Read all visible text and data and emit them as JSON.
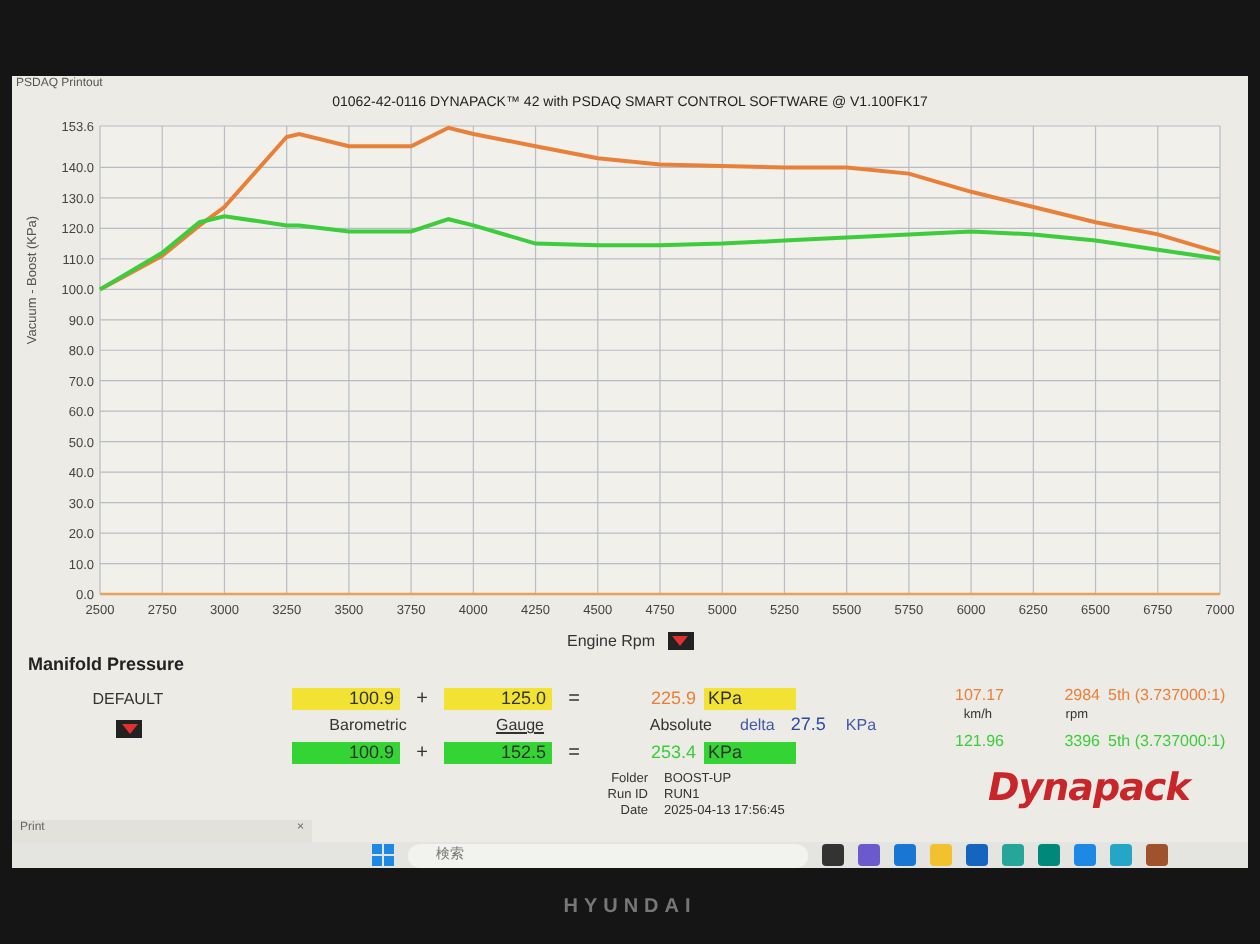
{
  "window": {
    "title": "PSDAQ Printout"
  },
  "chart": {
    "chart_data": {
      "type": "line",
      "title": "01062-42-0116 DYNAPACK™ 42 with PSDAQ SMART CONTROL SOFTWARE @ V1.100FK17",
      "xlabel": "Engine Rpm",
      "ylabel": "Vacuum - Boost (KPa)",
      "x": [
        2500,
        2750,
        2900,
        3000,
        3250,
        3300,
        3500,
        3750,
        3900,
        4000,
        4250,
        4500,
        4750,
        5000,
        5250,
        5500,
        5750,
        6000,
        6250,
        6500,
        6750,
        7000
      ],
      "series": [
        {
          "color": "#e8803a",
          "values": [
            100,
            111,
            121,
            127,
            150,
            151,
            147,
            147,
            153,
            151,
            147,
            143,
            141,
            140.5,
            140,
            140,
            138,
            132,
            127,
            122,
            118,
            112
          ]
        },
        {
          "color": "#3ccc3c",
          "values": [
            100,
            112,
            122,
            124,
            121,
            121,
            119,
            119,
            123,
            121,
            115,
            114.5,
            114.5,
            115,
            116,
            117,
            118,
            119,
            118,
            116,
            113,
            110
          ]
        }
      ],
      "grid": true,
      "xlim": [
        2500,
        7000
      ],
      "ylim": [
        0,
        153.6
      ],
      "xticks": [
        2500,
        2750,
        3000,
        3250,
        3500,
        3750,
        4000,
        4250,
        4500,
        4750,
        5000,
        5250,
        5500,
        5750,
        6000,
        6250,
        6500,
        6750,
        7000
      ],
      "yticks": [
        {
          "value": 0,
          "label": "0.0"
        },
        {
          "value": 10,
          "label": "10.0"
        },
        {
          "value": 20,
          "label": "20.0"
        },
        {
          "value": 30,
          "label": "30.0"
        },
        {
          "value": 40,
          "label": "40.0"
        },
        {
          "value": 50,
          "label": "50.0"
        },
        {
          "value": 60,
          "label": "60.0"
        },
        {
          "value": 70,
          "label": "70.0"
        },
        {
          "value": 80,
          "label": "80.0"
        },
        {
          "value": 90,
          "label": "90.0"
        },
        {
          "value": 100,
          "label": "100.0"
        },
        {
          "value": 110,
          "label": "110.0"
        },
        {
          "value": 120,
          "label": "120.0"
        },
        {
          "value": 130,
          "label": "130.0"
        },
        {
          "value": 140,
          "label": "140.0"
        },
        {
          "value": 153.6,
          "label": "153.6"
        }
      ]
    }
  },
  "panel": {
    "title": "Manifold Pressure",
    "preset": "DEFAULT",
    "labels": {
      "barometric": "Barometric",
      "gauge": "Gauge",
      "absolute": "Absolute",
      "speed": "km/h",
      "rpm": "rpm"
    },
    "runs": [
      {
        "barometric": "100.9",
        "plus": "+",
        "gauge": "125.0",
        "equals": "=",
        "absolute": "225.9",
        "unit": "KPa",
        "speed": "107.17",
        "rpm": "2984",
        "gear": "5th (3.737000:1)",
        "color": "#f2e233"
      },
      {
        "barometric": "100.9",
        "plus": "+",
        "gauge": "152.5",
        "equals": "=",
        "absolute": "253.4",
        "unit": "KPa",
        "speed": "121.96",
        "rpm": "3396",
        "gear": "5th (3.737000:1)",
        "color": "#33d433"
      }
    ],
    "delta": {
      "label": "delta",
      "value": "27.5",
      "unit": "KPa"
    },
    "info": [
      {
        "label": "Folder",
        "value": "BOOST-UP"
      },
      {
        "label": "Run ID",
        "value": "RUN1"
      },
      {
        "label": "Date",
        "value": "2025-04-13 17:56:45"
      }
    ],
    "logo": "Dynapack"
  },
  "print_window": {
    "title": "Print",
    "close": "×"
  },
  "taskbar": {
    "search_placeholder": "検索"
  },
  "bezel": {
    "brand": "HYUNDAI"
  }
}
